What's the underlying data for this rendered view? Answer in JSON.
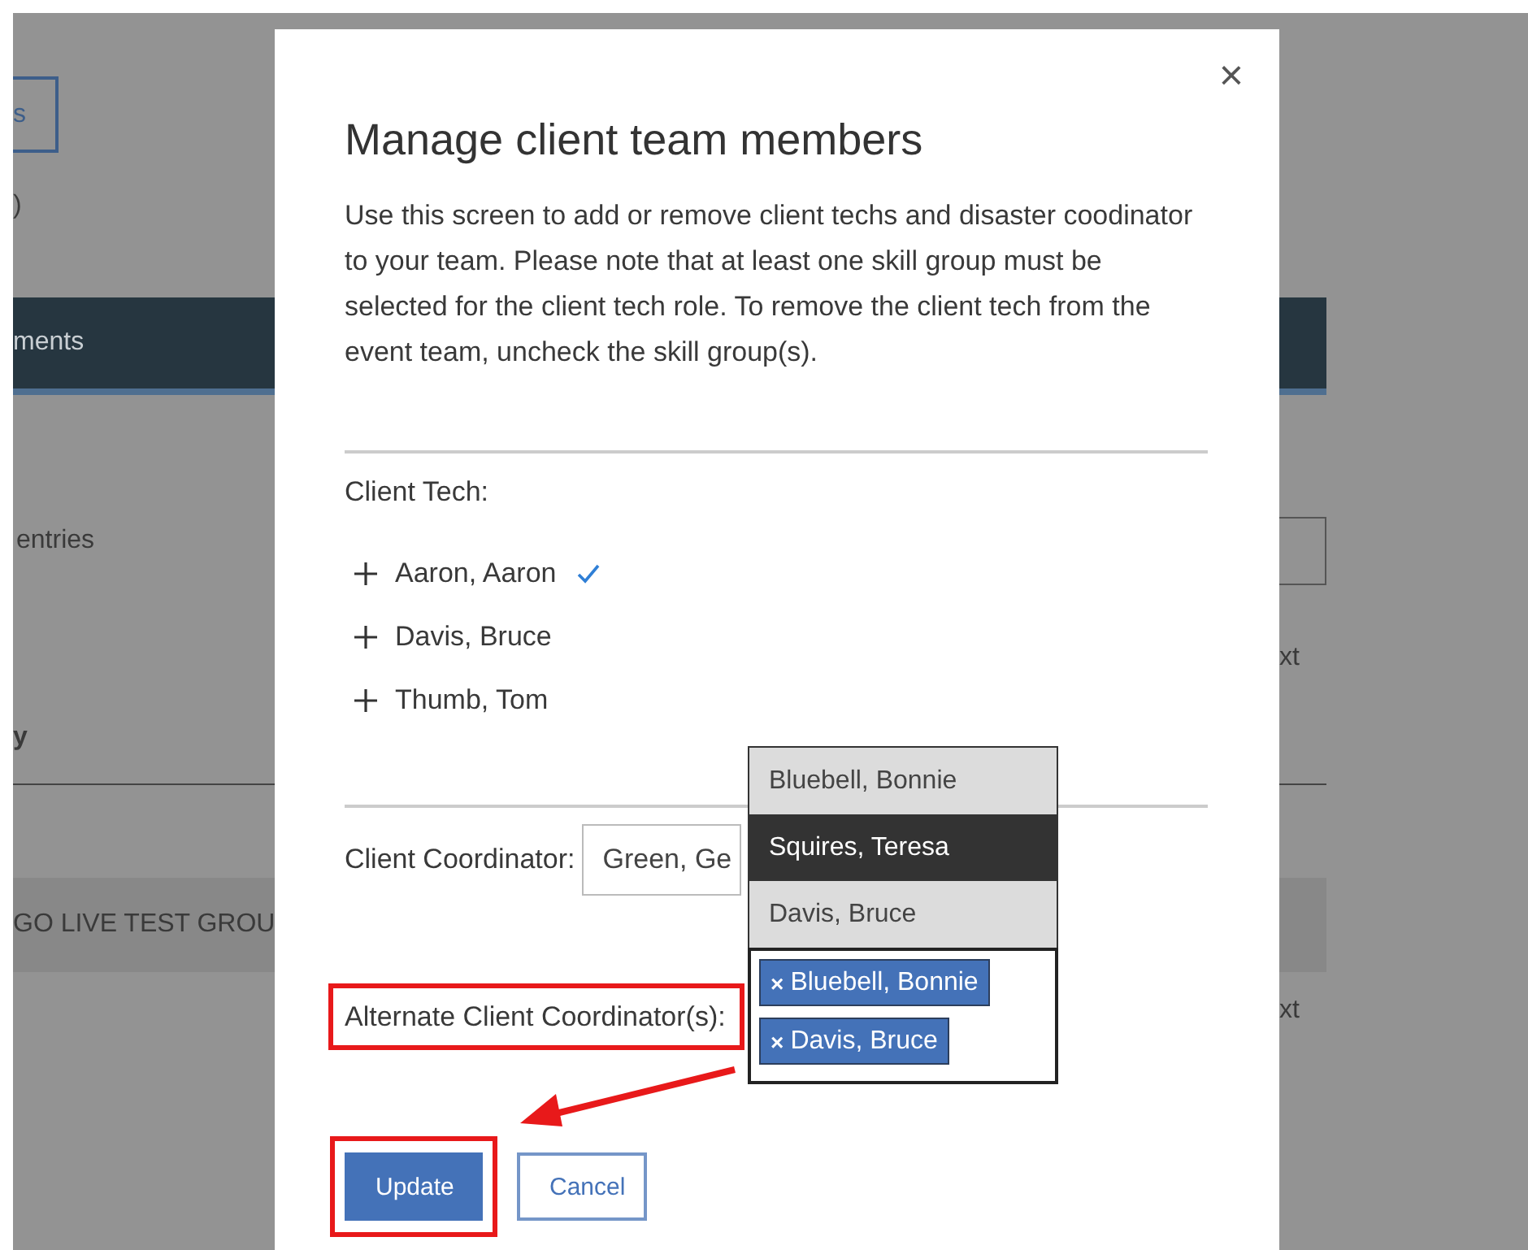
{
  "background": {
    "button_label": "s",
    "count_text": ")",
    "bar_label": "ments",
    "entries_text": "entries",
    "side_text_1": "xt",
    "column_heading": "y",
    "row_text": "GO LIVE TEST GROU",
    "side_text_2": "xt"
  },
  "dialog": {
    "close": "×",
    "title": "Manage client team members",
    "description": "Use this screen to add or remove client techs and disaster coodinator to your team. Please note that at least one skill group must be selected for the client tech role. To remove the client tech from the event team, uncheck the skill group(s).",
    "client_tech": {
      "label": "Client Tech:",
      "items": [
        {
          "name": "Aaron, Aaron",
          "checked": true
        },
        {
          "name": "Davis, Bruce",
          "checked": false
        },
        {
          "name": "Thumb, Tom",
          "checked": false
        }
      ]
    },
    "client_coordinator": {
      "label": "Client Coordinator:",
      "value": "Green, Ge"
    },
    "alternate": {
      "label": "Alternate Client Coordinator(s):",
      "options": [
        {
          "name": "Bluebell, Bonnie",
          "highlighted": false
        },
        {
          "name": "Squires, Teresa",
          "highlighted": true
        },
        {
          "name": "Davis, Bruce",
          "highlighted": false
        }
      ],
      "tags": [
        {
          "remove": "×",
          "name": "Bluebell, Bonnie"
        },
        {
          "remove": "×",
          "name": "Davis, Bruce"
        }
      ]
    },
    "buttons": [
      {
        "label": "Update",
        "kind": "primary"
      },
      {
        "label": "Cancel",
        "kind": "secondary"
      }
    ]
  }
}
